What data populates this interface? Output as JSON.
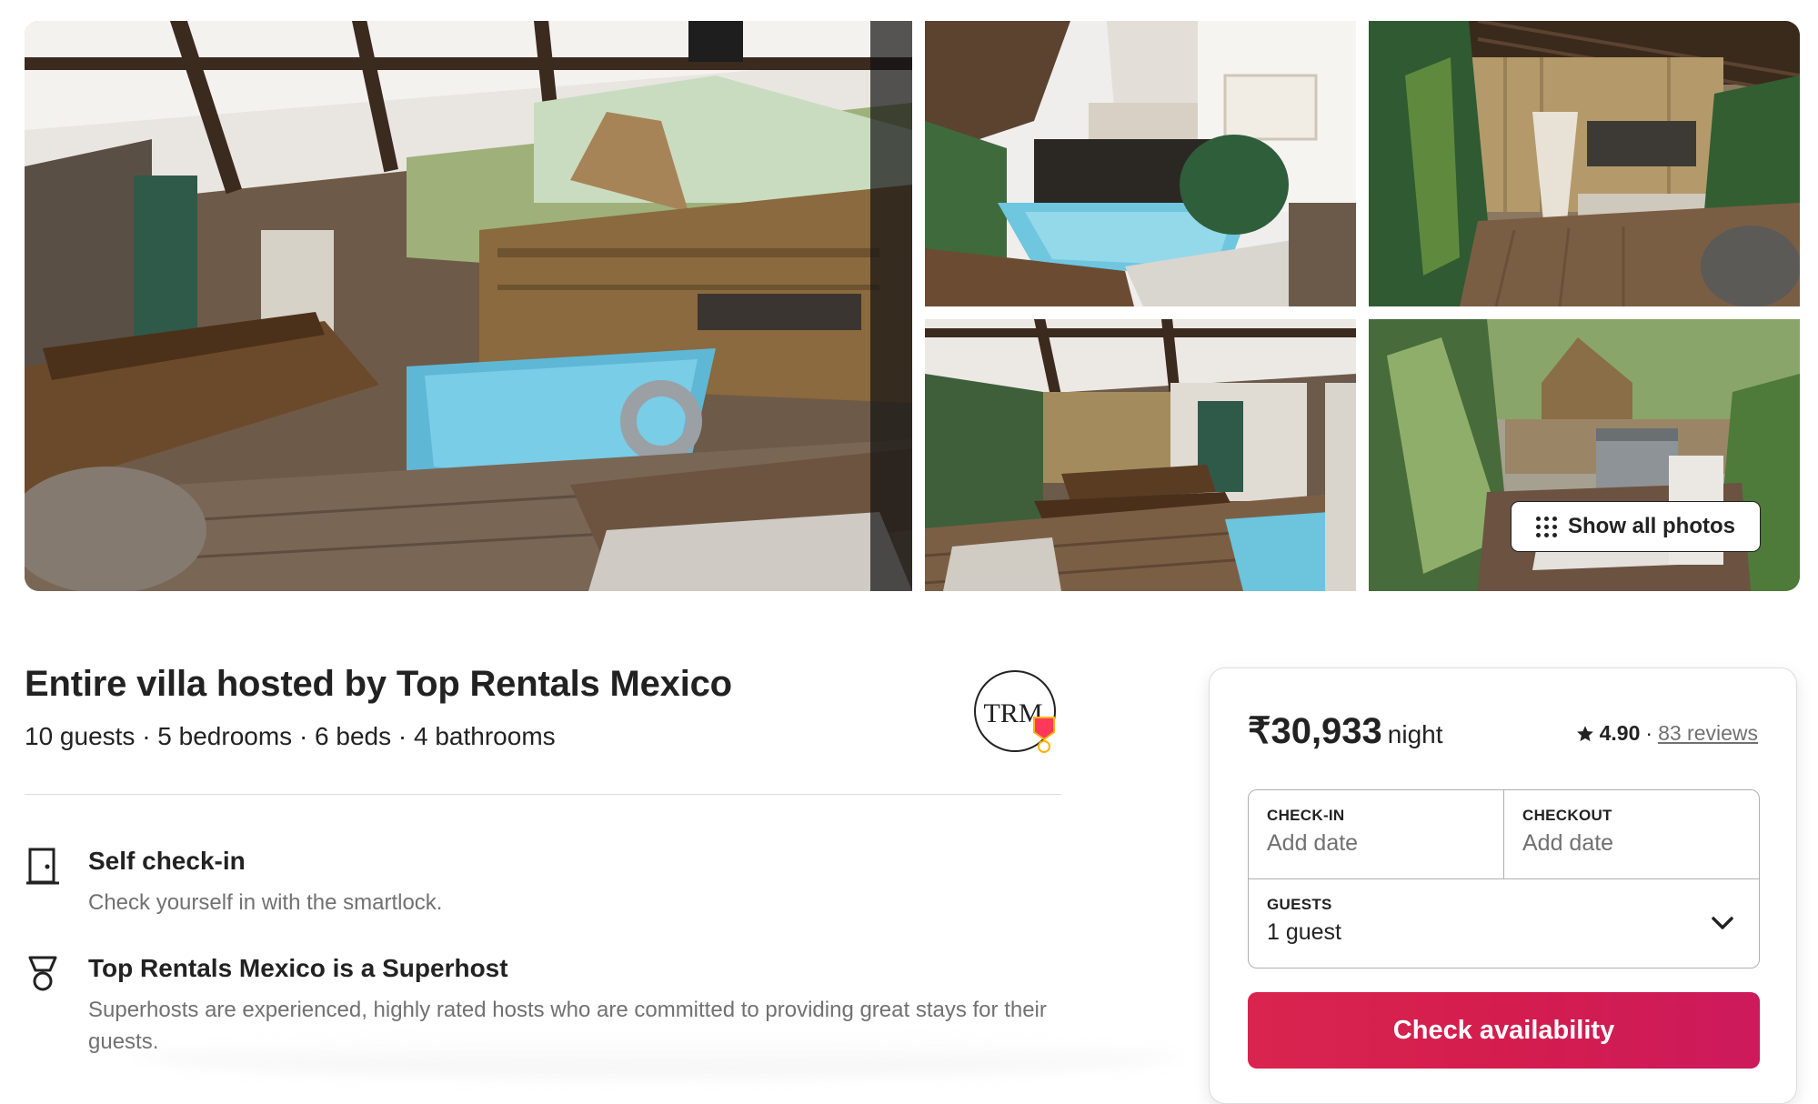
{
  "gallery": {
    "photos": [
      "pool-patio-main",
      "pool-courtyard",
      "hammock-patio",
      "dining-terrace",
      "garden-grill"
    ],
    "show_all_label": "Show all photos"
  },
  "listing": {
    "title": "Entire villa hosted by Top Rentals Mexico",
    "details": "10 guests · 5 bedrooms · 6 beds · 4 bathrooms",
    "host_logo_text": "TRM"
  },
  "features": [
    {
      "icon": "door-icon",
      "title": "Self check-in",
      "description": "Check yourself in with the smartlock."
    },
    {
      "icon": "superhost-medal-icon",
      "title": "Top Rentals Mexico is a Superhost",
      "description": "Superhosts are experienced, highly rated hosts who are committed to providing great stays for their guests."
    }
  ],
  "booking": {
    "price": "₹30,933",
    "per": "night",
    "rating": "4.90",
    "separator": "·",
    "reviews": "83 reviews",
    "checkin_label": "CHECK-IN",
    "checkin_value": "Add date",
    "checkout_label": "CHECKOUT",
    "checkout_value": "Add date",
    "guests_label": "GUESTS",
    "guests_value": "1 guest",
    "cta_label": "Check availability"
  },
  "colors": {
    "brand": "#d9244f",
    "text": "#222222",
    "muted": "#717171",
    "border": "#b0b0b0"
  }
}
